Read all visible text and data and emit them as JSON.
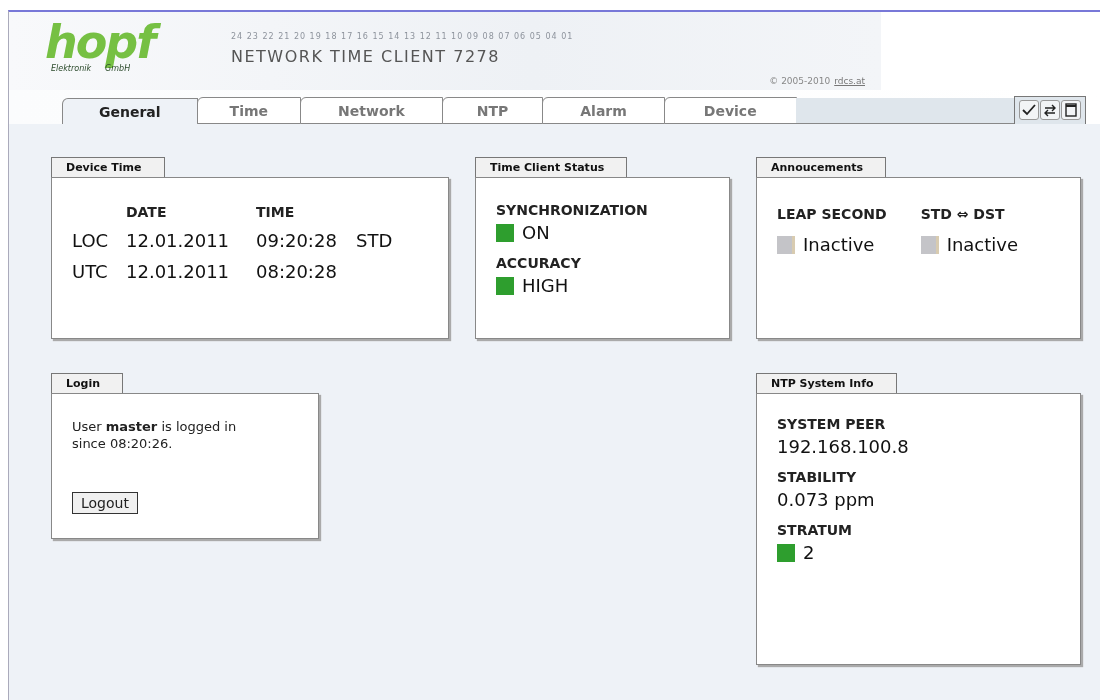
{
  "header": {
    "logo": {
      "word": "hopf",
      "left": "Elektronik",
      "right": "GmbH"
    },
    "scale": "24 23 22 21 20 19 18 17 16 15 14 13 12 11 10 09 08 07 06 05 04 01",
    "title": "NETWORK TIME CLIENT 7278",
    "copyright": "© 2005-2010",
    "copyright_link": "rdcs.at"
  },
  "tabs": [
    {
      "label": "General",
      "selected": true
    },
    {
      "label": "Time",
      "selected": false
    },
    {
      "label": "Network",
      "selected": false
    },
    {
      "label": "NTP",
      "selected": false
    },
    {
      "label": "Alarm",
      "selected": false
    },
    {
      "label": "Device",
      "selected": false
    }
  ],
  "toolbar": [
    {
      "kind": "check"
    },
    {
      "kind": "swap"
    },
    {
      "kind": "window"
    }
  ],
  "device_time": {
    "title": "Device Time",
    "columns": [
      "DATE",
      "TIME"
    ],
    "rows": [
      {
        "label": "LOC",
        "date": "12.01.2011",
        "time": "09:20:28",
        "zone": "STD"
      },
      {
        "label": "UTC",
        "date": "12.01.2011",
        "time": "08:20:28"
      }
    ]
  },
  "time_client_status": {
    "title": "Time Client Status",
    "items": [
      {
        "label": "SYNCHRONIZATION",
        "value": "ON",
        "color": "#2e9e2e"
      },
      {
        "label": "ACCURACY",
        "value": "HIGH",
        "color": "#2e9e2e"
      }
    ]
  },
  "announcements": {
    "title": "Annoucements",
    "items": [
      {
        "label": "LEAP SECOND",
        "value": "Inactive",
        "color": "#c4c4c8"
      },
      {
        "label": "STD ⇔ DST",
        "value": "Inactive",
        "color": "#c4c4c8"
      }
    ]
  },
  "login": {
    "title": "Login",
    "message": "User **master** is logged in since 08:20:26.",
    "button": "Logout"
  },
  "ntp_system_info": {
    "title": "NTP System Info",
    "items": [
      {
        "kind": "text",
        "label": "SYSTEM PEER",
        "value": "192.168.100.8"
      },
      {
        "kind": "text",
        "label": "STABILITY",
        "value": "0.073 ppm"
      },
      {
        "kind": "status",
        "label": "STRATUM",
        "value": "2",
        "color": "#2e9e2e"
      }
    ]
  }
}
